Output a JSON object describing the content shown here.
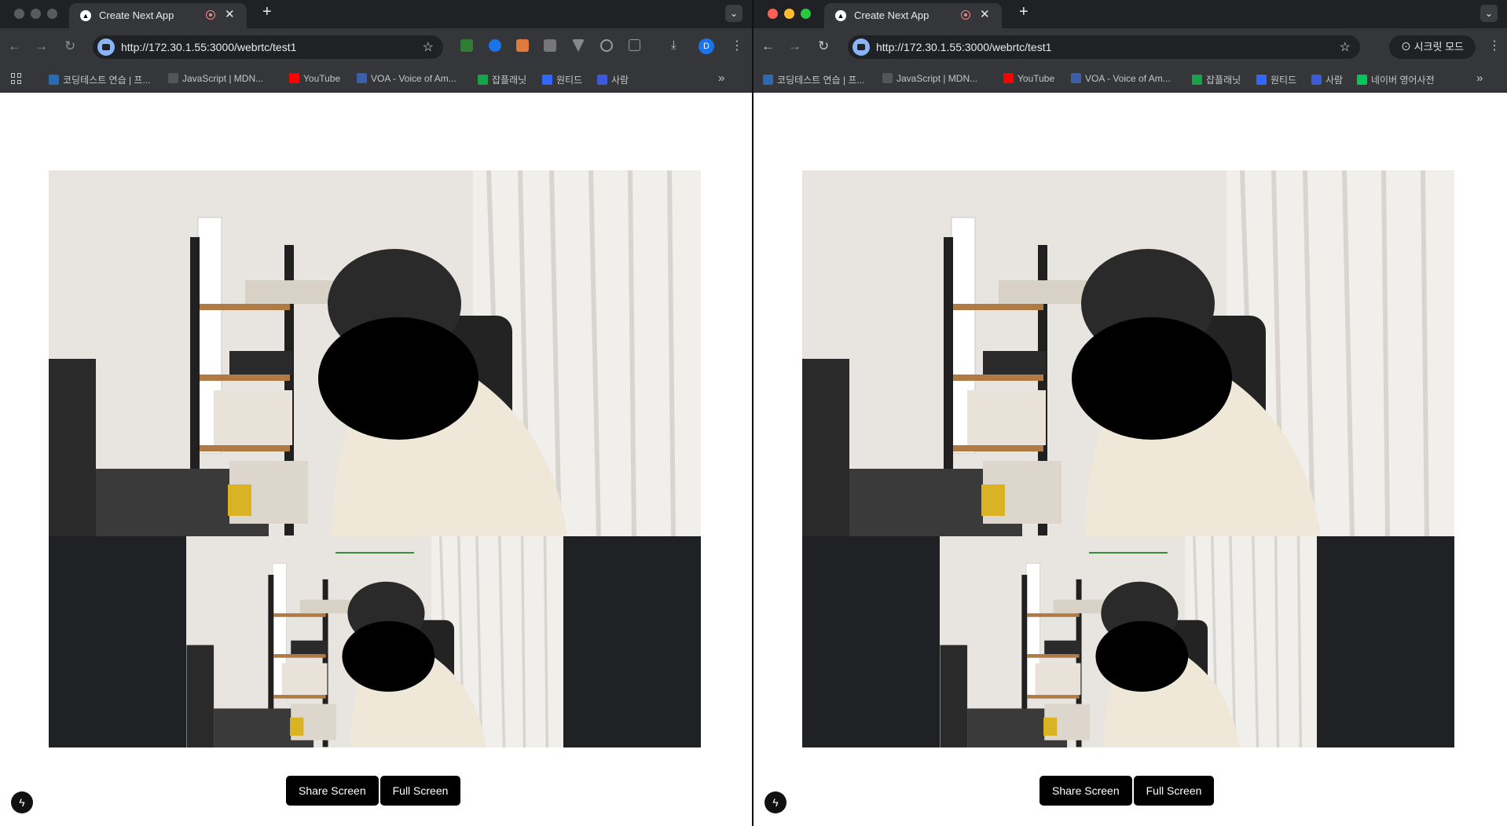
{
  "windows": [
    {
      "tab_title": "Create Next App",
      "url": "http://172.30.1.55:3000/webrtc/test1",
      "incognito": "",
      "bookmarks": [
        "코딩테스트 연습 | 프...",
        "JavaScript | MDN...",
        "YouTube",
        "VOA - Voice of Am...",
        "잡플래닛",
        "원티드",
        "사람"
      ],
      "buttons": {
        "share": "Share Screen",
        "full": "Full Screen"
      },
      "avatar": "D"
    },
    {
      "tab_title": "Create Next App",
      "url": "http://172.30.1.55:3000/webrtc/test1",
      "incognito": "시크릿 모드",
      "bookmarks": [
        "코딩테스트 연습 | 프...",
        "JavaScript | MDN...",
        "YouTube",
        "VOA - Voice of Am...",
        "잡플래닛",
        "원티드",
        "사람",
        "네이버 영어사전"
      ],
      "buttons": {
        "share": "Share Screen",
        "full": "Full Screen"
      }
    }
  ],
  "colors": {
    "toolbar": "#35363a",
    "titlebar": "#202124",
    "button": "#000000"
  },
  "icons": {
    "back": "arrow-left-icon",
    "forward": "arrow-right-icon",
    "reload": "reload-icon",
    "star": "star-icon",
    "menu": "kebab-icon",
    "next": "nextjs-icon"
  }
}
